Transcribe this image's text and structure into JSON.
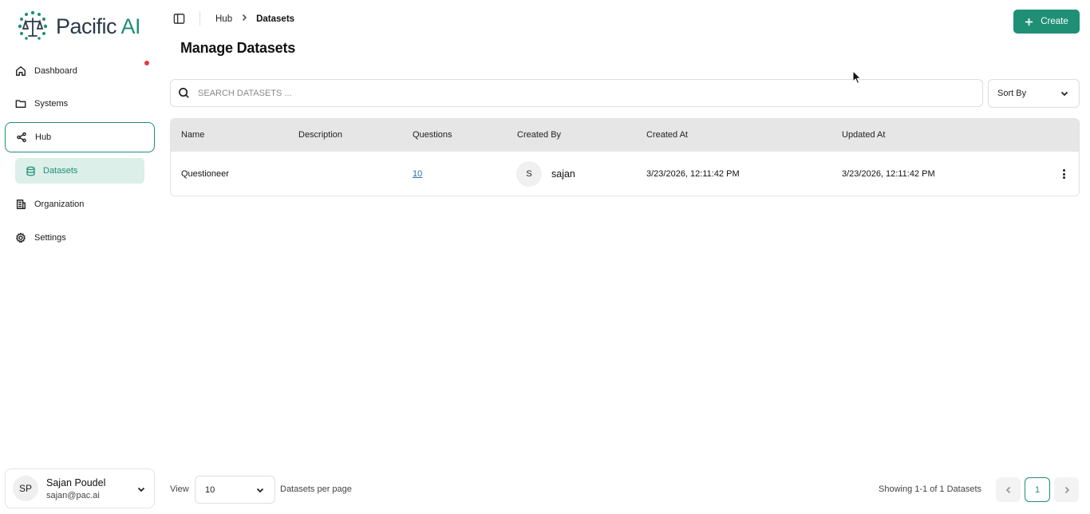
{
  "brand": {
    "name_main": "Pacific",
    "name_accent": "AI",
    "accent_color": "#1f8f76"
  },
  "sidebar": {
    "items": [
      {
        "label": "Dashboard",
        "icon": "home-icon"
      },
      {
        "label": "Systems",
        "icon": "folder-icon"
      },
      {
        "label": "Hub",
        "icon": "share-icon",
        "active": true
      },
      {
        "label": "Organization",
        "icon": "building-icon"
      },
      {
        "label": "Settings",
        "icon": "gear-icon"
      }
    ],
    "sub_item": {
      "label": "Datasets",
      "icon": "database-icon",
      "active": true
    }
  },
  "user": {
    "initials": "SP",
    "name": "Sajan Poudel",
    "email": "sajan@pac.ai"
  },
  "header": {
    "breadcrumb": [
      "Hub",
      "Datasets"
    ],
    "create_label": "Create",
    "page_title": "Manage Datasets"
  },
  "search": {
    "placeholder": "SEARCH DATASETS ...",
    "value": ""
  },
  "sort": {
    "label": "Sort By"
  },
  "table": {
    "columns": [
      "Name",
      "Description",
      "Questions",
      "Created By",
      "Created At",
      "Updated At"
    ],
    "rows": [
      {
        "name": "Questioneer",
        "description": "",
        "questions": "10",
        "creator_initial": "S",
        "created_by": "sajan",
        "created_at": "3/23/2026, 12:11:42 PM",
        "updated_at": "3/23/2026, 12:11:42 PM"
      }
    ]
  },
  "pagination": {
    "view_label": "View",
    "per_page_value": "10",
    "per_page_label": "Datasets per page",
    "showing": "Showing 1-1 of 1 Datasets",
    "current_page": "1"
  }
}
